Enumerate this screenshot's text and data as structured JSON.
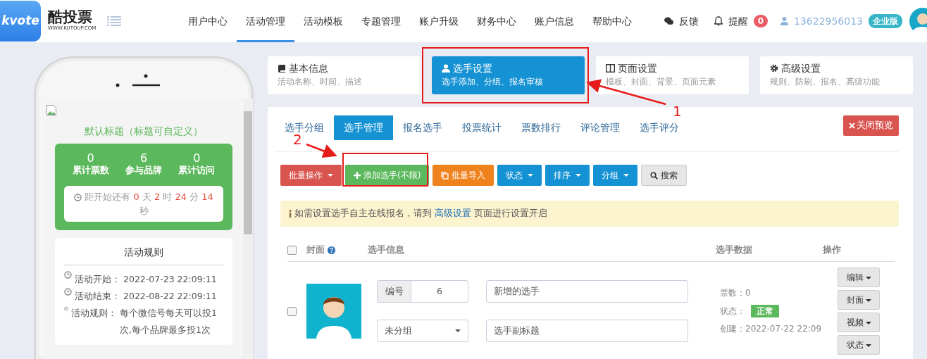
{
  "header": {
    "logo_text": "kvote",
    "brand": "酷投票",
    "brand_url": "WWW.KUTOUP.COM",
    "nav": [
      {
        "label": "用户中心",
        "selected": false
      },
      {
        "label": "活动管理",
        "selected": true
      },
      {
        "label": "活动模板",
        "selected": false
      },
      {
        "label": "专题管理",
        "selected": false
      },
      {
        "label": "账户升级",
        "selected": false
      },
      {
        "label": "财务中心",
        "selected": false
      },
      {
        "label": "账户信息",
        "selected": false
      },
      {
        "label": "帮助中心",
        "selected": false
      }
    ],
    "feedback": "反馈",
    "reminder": {
      "label": "提醒",
      "count": "0"
    },
    "user": "13622956013",
    "plan": "企业版"
  },
  "preview": {
    "title": "默认标题（标题可自定义）",
    "stats": [
      {
        "value": "0",
        "label": "累计票数"
      },
      {
        "value": "6",
        "label": "参与品牌"
      },
      {
        "value": "0",
        "label": "累计访问"
      }
    ],
    "countdown": {
      "prefix": "距开始还有",
      "parts": [
        {
          "num": "0",
          "unit": "天"
        },
        {
          "num": "2",
          "unit": "时"
        },
        {
          "num": "24",
          "unit": "分"
        },
        {
          "num": "14",
          "unit": "秒"
        }
      ]
    },
    "rules": {
      "title": "活动规则",
      "items": [
        {
          "kind": "clock",
          "label": "活动开始：",
          "value": "2022-07-23 22:09:11"
        },
        {
          "kind": "clock",
          "label": "活动结束：",
          "value": "2022-08-22 22:09:11"
        },
        {
          "kind": "check",
          "label": "活动规则：",
          "value": "每个微信号每天可以投1次,每个品牌最多投1次"
        }
      ]
    }
  },
  "steps": [
    {
      "title": "基本信息",
      "subtitle": "活动名称、时间、描述",
      "selected": false
    },
    {
      "title": "选手设置",
      "subtitle": "选手添加、分组、报名审核",
      "selected": true
    },
    {
      "title": "页面设置",
      "subtitle": "模板、封面、背景、页面元素",
      "selected": false
    },
    {
      "title": "高级设置",
      "subtitle": "规则、防刷、报名、高级功能",
      "selected": false
    }
  ],
  "tabs": [
    {
      "label": "选手分组",
      "selected": false
    },
    {
      "label": "选手管理",
      "selected": true
    },
    {
      "label": "报名选手",
      "selected": false
    },
    {
      "label": "投票统计",
      "selected": false
    },
    {
      "label": "票数排行",
      "selected": false
    },
    {
      "label": "评论管理",
      "selected": false
    },
    {
      "label": "选手评分",
      "selected": false
    }
  ],
  "close_preview": "关闭预览",
  "toolbar": [
    {
      "label": "批量操作",
      "kind": "danger",
      "caret": true
    },
    {
      "label": "添加选手(不限)",
      "kind": "success",
      "caret": false
    },
    {
      "label": "批量导入",
      "kind": "warning",
      "caret": false
    },
    {
      "label": "状态",
      "kind": "primary",
      "caret": true
    },
    {
      "label": "排序",
      "kind": "primary",
      "caret": true
    },
    {
      "label": "分组",
      "kind": "primary",
      "caret": true
    },
    {
      "label": "搜索",
      "kind": "default",
      "caret": false
    }
  ],
  "alert": {
    "text": "如需设置选手自主在线报名，请到",
    "link": "高级设置",
    "after": "页面进行设置开启"
  },
  "table": {
    "select_all": false,
    "columns": [
      "封面",
      "选手信息",
      "选手数据",
      "操作"
    ],
    "rows": [
      {
        "checked": false,
        "number_label": "编号",
        "number": "6",
        "name": "新增的选手",
        "group": "未分组",
        "subtitle": "选手副标题",
        "votes": "票数：0",
        "status_label": "状态：",
        "status": "正常",
        "created": "创建：2022-07-22 22:09",
        "actions": [
          "编辑",
          "封面",
          "视频",
          "状态"
        ]
      }
    ]
  },
  "annotations": [
    {
      "label": "1"
    },
    {
      "label": "2"
    }
  ]
}
